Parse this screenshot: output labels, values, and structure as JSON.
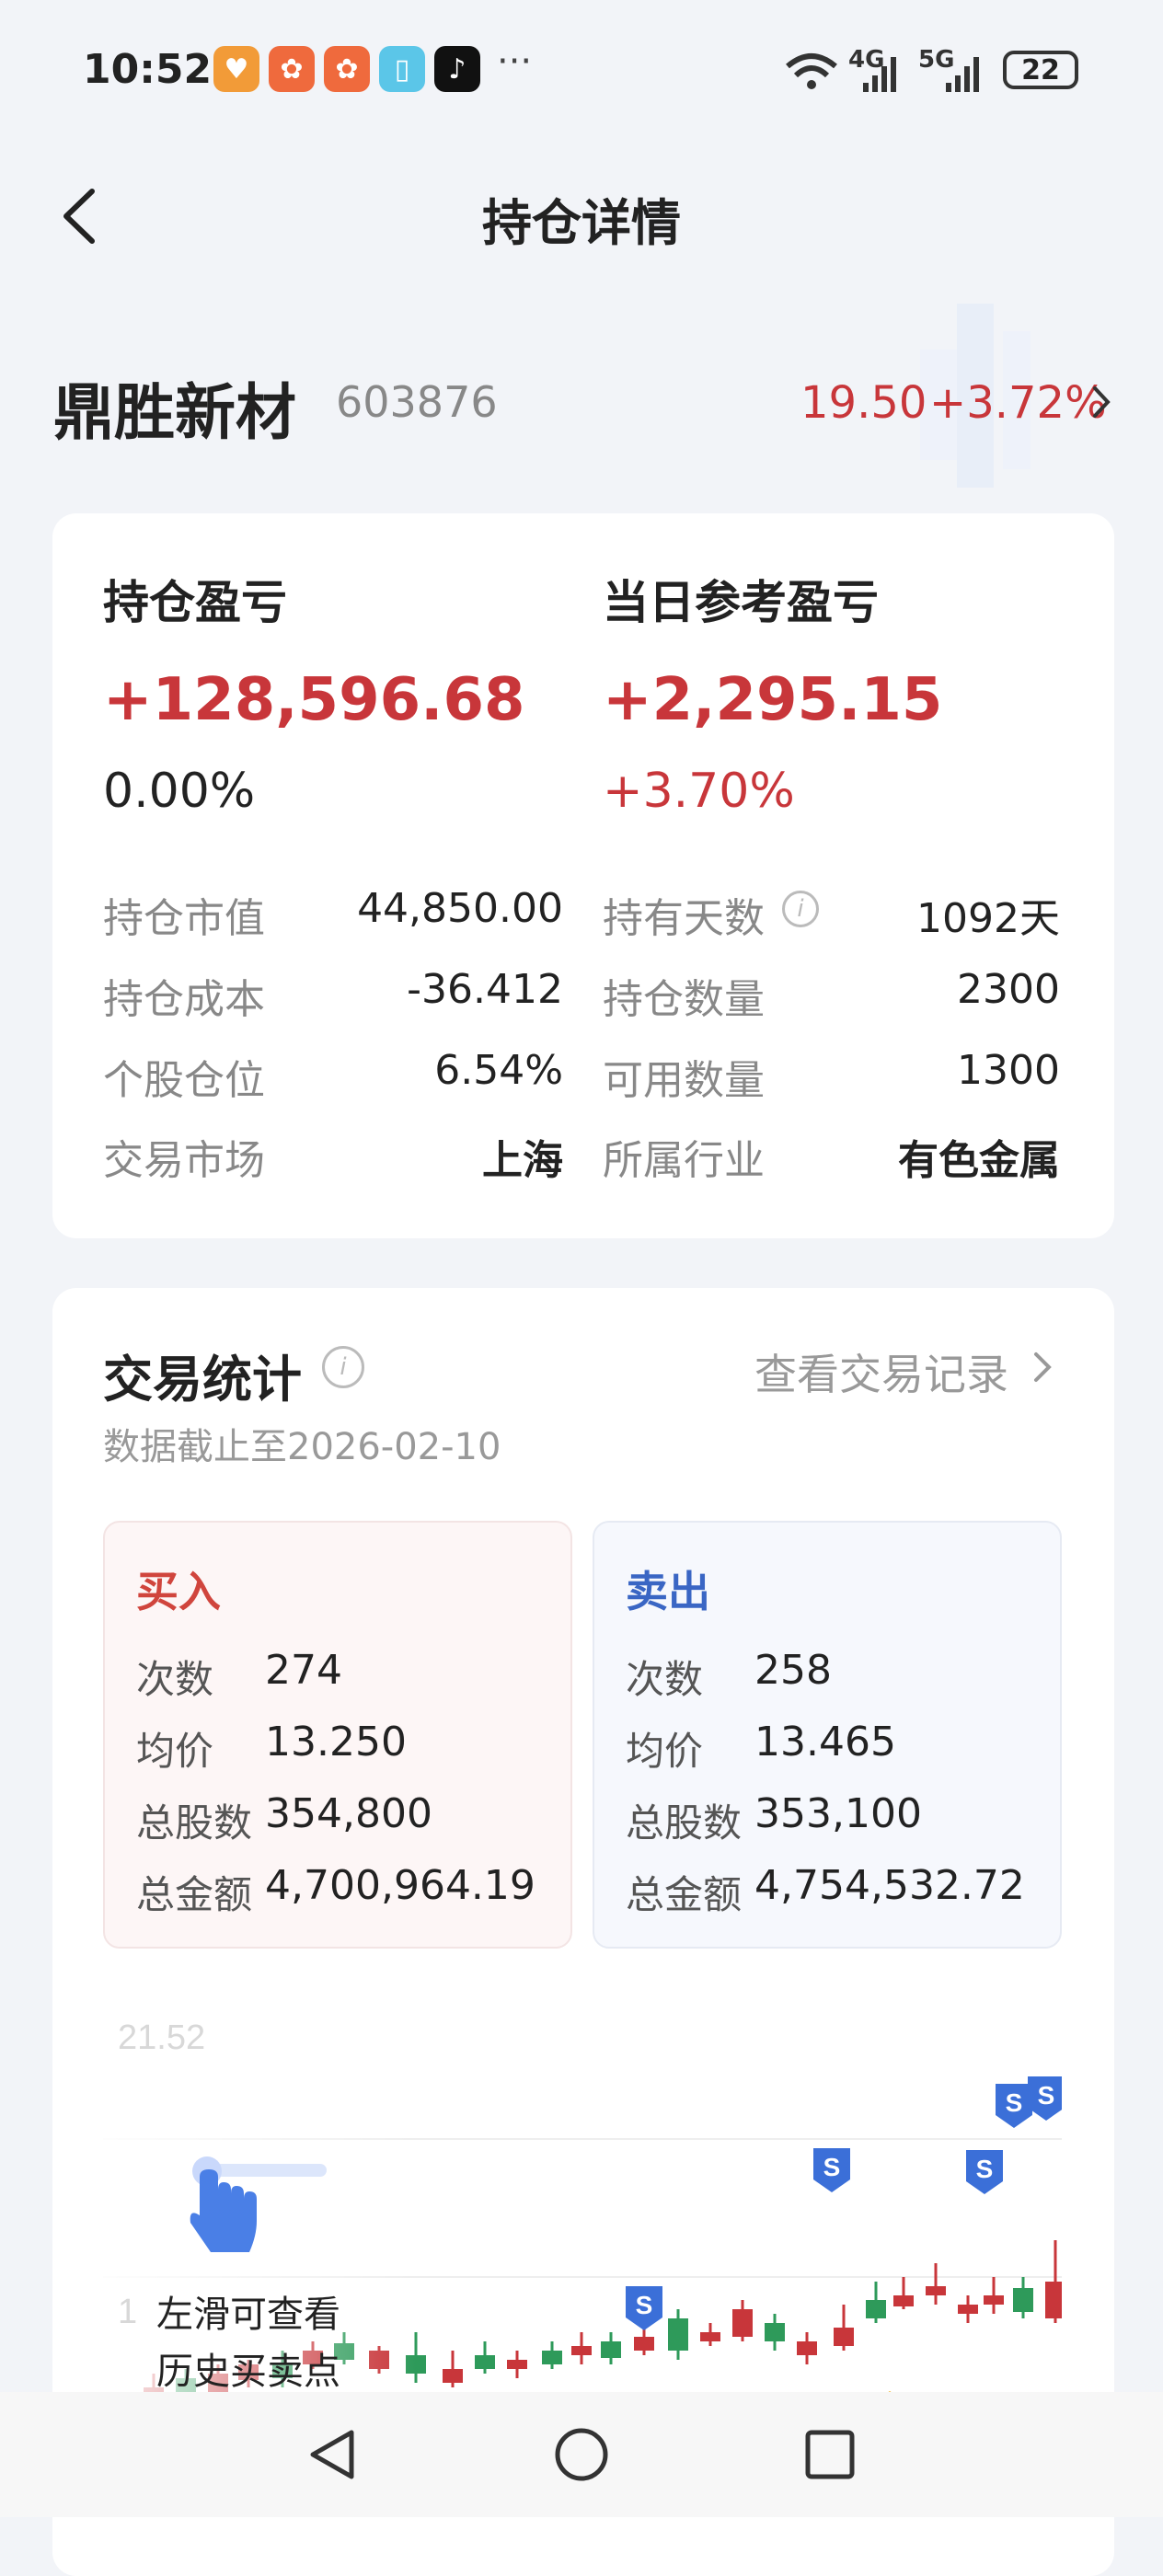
{
  "status_bar": {
    "time": "10:52",
    "network_4g": "4G",
    "network_5g": "5G",
    "battery": "22"
  },
  "header": {
    "title": "持仓详情"
  },
  "stock": {
    "name": "鼎胜新材",
    "code": "603876",
    "price": "19.50",
    "change_pct": "+3.72%"
  },
  "position": {
    "holding_pl_label": "持仓盈亏",
    "holding_pl_value": "+128,596.68",
    "holding_pl_pct": "0.00%",
    "daily_pl_label": "当日参考盈亏",
    "daily_pl_value": "+2,295.15",
    "daily_pl_pct": "+3.70%",
    "left_rows": [
      {
        "label": "持仓市值",
        "value": "44,850.00"
      },
      {
        "label": "持仓成本",
        "value": "-36.412"
      },
      {
        "label": "个股仓位",
        "value": "6.54%"
      },
      {
        "label": "交易市场",
        "value": "上海"
      }
    ],
    "right_rows": [
      {
        "label": "持有天数",
        "value": "1092天"
      },
      {
        "label": "持仓数量",
        "value": "2300"
      },
      {
        "label": "可用数量",
        "value": "1300"
      },
      {
        "label": "所属行业",
        "value": "有色金属"
      }
    ]
  },
  "trade_stats": {
    "title": "交易统计",
    "view_records": "查看交易记录",
    "as_of": "数据截止至2026-02-10",
    "buy": {
      "title": "买入",
      "rows": [
        {
          "label": "次数",
          "value": "274"
        },
        {
          "label": "均价",
          "value": "13.250"
        },
        {
          "label": "总股数",
          "value": "354,800"
        },
        {
          "label": "总金额",
          "value": "4,700,964.19"
        }
      ]
    },
    "sell": {
      "title": "卖出",
      "rows": [
        {
          "label": "次数",
          "value": "258"
        },
        {
          "label": "均价",
          "value": "13.465"
        },
        {
          "label": "总股数",
          "value": "353,100"
        },
        {
          "label": "总金额",
          "value": "4,754,532.72"
        }
      ]
    },
    "chart_max_label": "21.52",
    "chart_low_label": "1",
    "hint_line1": "左滑可查看",
    "hint_line2": "历史买卖点"
  },
  "colors": {
    "up": "#c8363a",
    "down": "#2e9a5a",
    "buy_marker": "#d9433e",
    "sell_marker": "#3b6fd8",
    "t_marker": "#f0b429"
  },
  "nav": {
    "back": "back-triangle-icon",
    "home": "home-circle-icon",
    "recents": "recents-square-icon"
  }
}
